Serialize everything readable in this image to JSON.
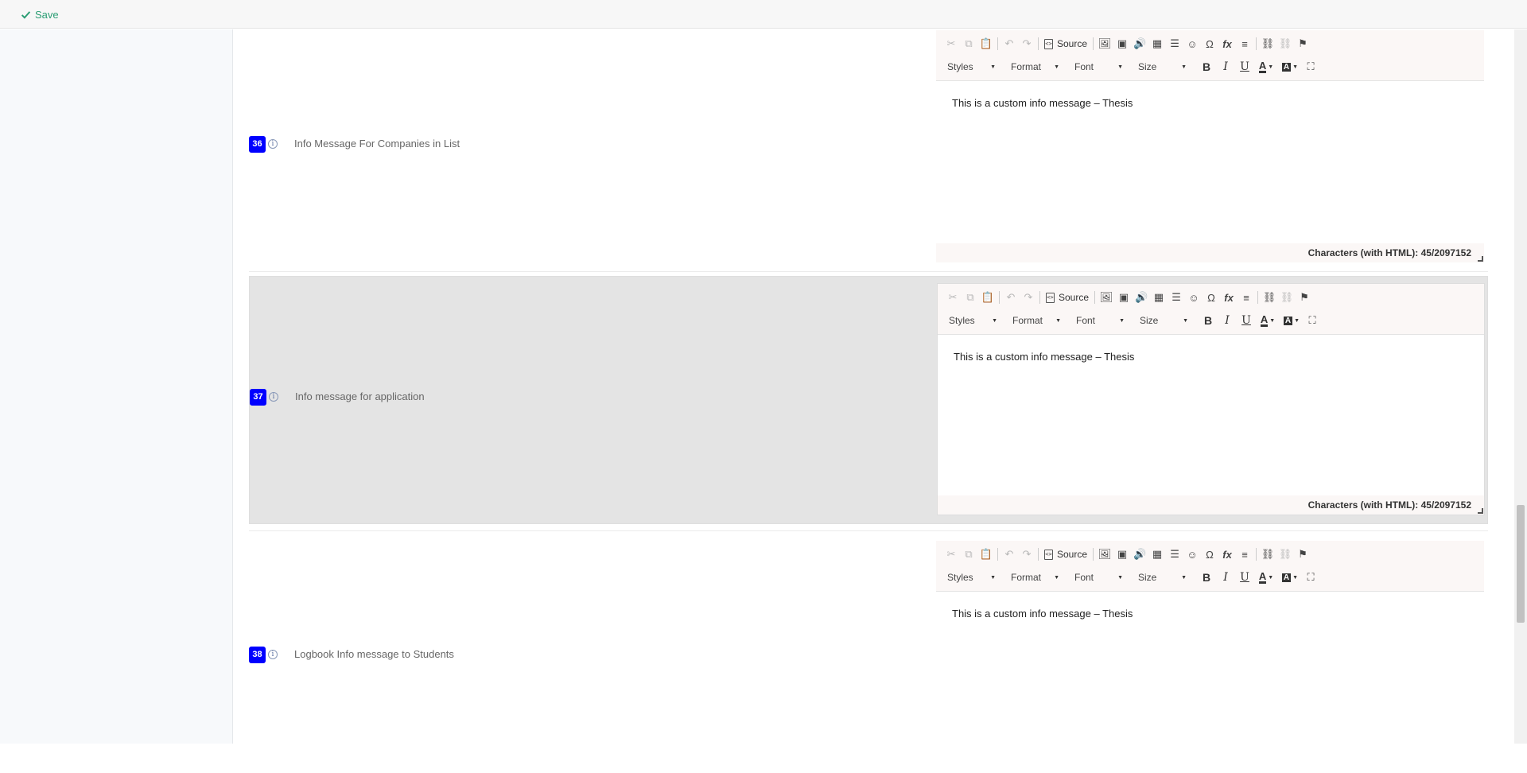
{
  "topbar": {
    "save_label": "Save"
  },
  "rows": [
    {
      "number": "36",
      "label": "Info Message For Companies in List",
      "content": "This is a custom info message – Thesis",
      "status": "Characters (with HTML): 45/2097152"
    },
    {
      "number": "37",
      "label": "Info message for application",
      "content": "This is a custom info message – Thesis",
      "status": "Characters (with HTML): 45/2097152"
    },
    {
      "number": "38",
      "label": "Logbook Info message to Students",
      "content": "This is a custom info message – Thesis",
      "status": ""
    }
  ],
  "editor_toolbar": {
    "source_label": "Source",
    "styles_label": "Styles",
    "format_label": "Format",
    "font_label": "Font",
    "size_label": "Size",
    "bold_label": "B",
    "italic_label": "I",
    "underline_label": "U",
    "text_color_label": "A",
    "bg_color_label": "A"
  },
  "colors": {
    "badge": "#0000ff",
    "save": "#2a9d73",
    "highlight_row": "#e4e4e4"
  }
}
